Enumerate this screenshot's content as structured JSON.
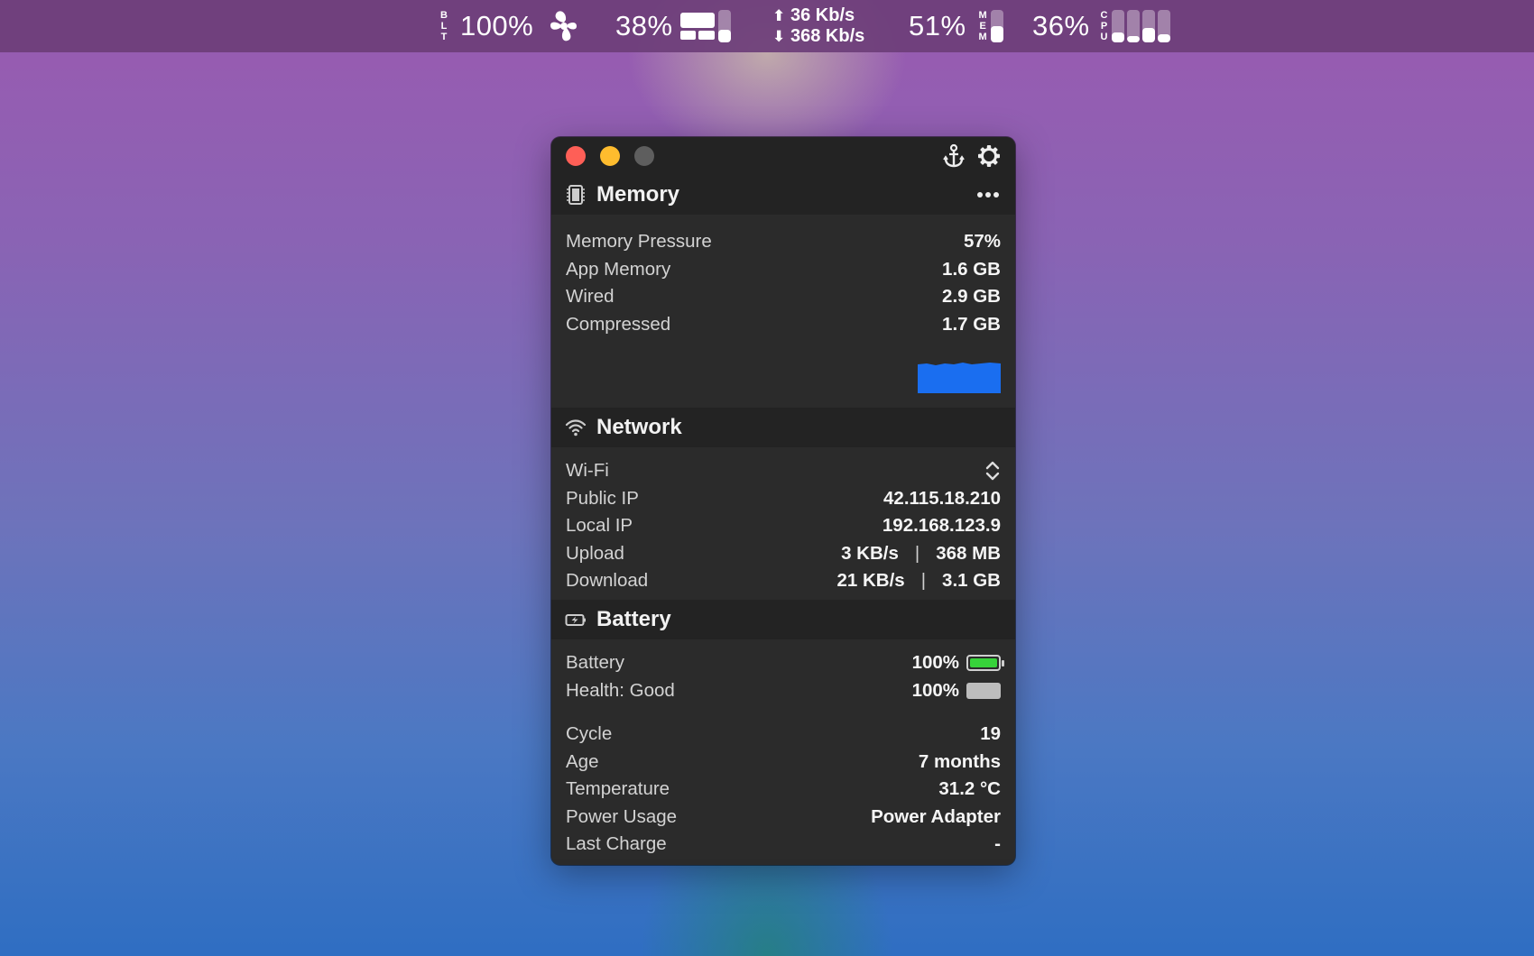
{
  "menubar": {
    "bluetooth_label": [
      "B",
      "L",
      "T"
    ],
    "bluetooth_pct": "100%",
    "fan_pct": "38%",
    "upload_rate": "36 Kb/s",
    "download_rate": "368 Kb/s",
    "memory_pct": "51%",
    "memory_label": [
      "M",
      "E",
      "M"
    ],
    "memory_level": 0.51,
    "disk_level": 0.38,
    "cpu_pct": "36%",
    "cpu_label": [
      "C",
      "P",
      "U"
    ],
    "cpu_core_levels": [
      0.3,
      0.2,
      0.45,
      0.25
    ]
  },
  "popup": {
    "memory": {
      "title": "Memory",
      "rows": [
        {
          "label": "Memory Pressure",
          "value": "57%"
        },
        {
          "label": "App Memory",
          "value": "1.6 GB"
        },
        {
          "label": "Wired",
          "value": "2.9 GB"
        },
        {
          "label": "Compressed",
          "value": "1.7 GB"
        }
      ],
      "chart_color": "#1a6ef0"
    },
    "network": {
      "title": "Network",
      "interface": "Wi-Fi",
      "public_ip_label": "Public IP",
      "public_ip": "42.115.18.210",
      "local_ip_label": "Local IP",
      "local_ip": "192.168.123.9",
      "upload_label": "Upload",
      "upload_rate": "3 KB/s",
      "upload_total": "368 MB",
      "download_label": "Download",
      "download_rate": "21 KB/s",
      "download_total": "3.1 GB",
      "separator": "|"
    },
    "battery": {
      "title": "Battery",
      "battery_label": "Battery",
      "battery_value": "100%",
      "battery_level": 1.0,
      "health_label": "Health: Good",
      "health_value": "100%",
      "rows": [
        {
          "label": "Cycle",
          "value": "19"
        },
        {
          "label": "Age",
          "value": "7 months"
        },
        {
          "label": "Temperature",
          "value": "31.2 °C"
        },
        {
          "label": "Power Usage",
          "value": "Power Adapter"
        },
        {
          "label": "Last Charge",
          "value": "-"
        }
      ],
      "battery_color": "#37d33a"
    }
  }
}
